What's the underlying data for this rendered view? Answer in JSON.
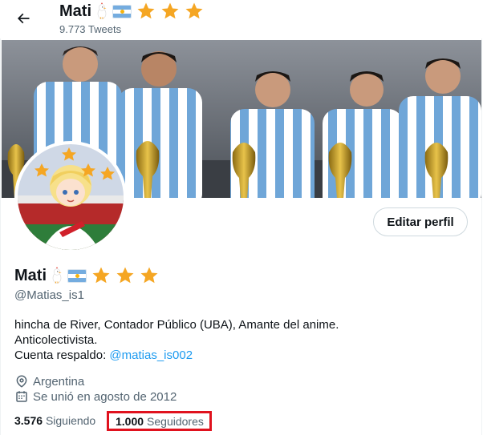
{
  "header": {
    "title": "Mati",
    "tweets_count": "9.773 Tweets"
  },
  "profile": {
    "name": "Mati",
    "handle": "@Matias_is1",
    "edit_button": "Editar perfil",
    "bio_line1": "hincha de River, Contador Público (UBA), Amante del anime.",
    "bio_line2": "Anticolectivista.",
    "bio_line3_prefix": "Cuenta respaldo: ",
    "bio_line3_link": "@matias_is002",
    "location": "Argentina",
    "joined": "Se unió en agosto de 2012",
    "following_count": "3.576",
    "following_label": "Siguiendo",
    "followers_count": "1.000",
    "followers_label": "Seguidores"
  },
  "icons": {
    "back": "arrow-left-icon",
    "location": "location-pin-icon",
    "calendar": "calendar-icon",
    "name_emojis": [
      "chicken-icon",
      "argentina-flag-icon",
      "star-icon",
      "star-icon",
      "star-icon"
    ]
  },
  "colors": {
    "link": "#1d9bf0",
    "secondary_text": "#536471",
    "star": "#f5a623",
    "highlight_box": "#e0121e"
  }
}
